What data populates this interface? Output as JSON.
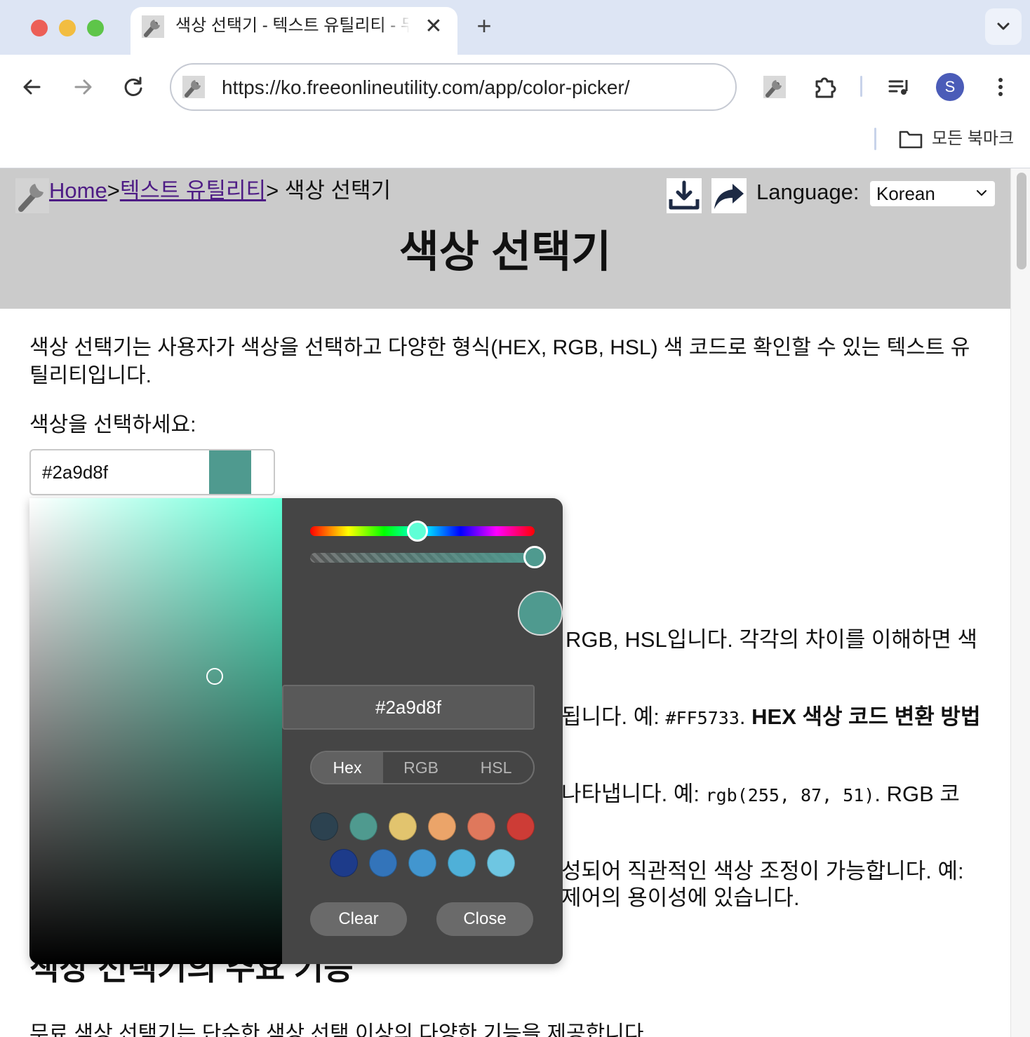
{
  "browser": {
    "tab_title": "색상 선택기 - 텍스트 유틸리티 - 무",
    "tab_close": "✕",
    "new_tab": "+",
    "url": "https://ko.freeonlineutility.com/app/color-picker/",
    "profile_initial": "S",
    "bookmarks_label": "모든 북마크"
  },
  "header": {
    "breadcrumb": {
      "home": "Home",
      "sep1": ">",
      "category": "텍스트 유틸리티",
      "sep2": ">",
      "current": " 색상 선택기"
    },
    "language_label": "Language:",
    "language_value": "Korean",
    "title": "색상 선택기"
  },
  "content": {
    "intro": "색상 선택기는 사용자가 색상을 선택하고 다양한 형식(HEX, RGB, HSL) 색 코드로 확인할 수 있는 텍스트 유틸리티입니다.",
    "pick_label": "색상을 선택하세요:",
    "input_value": "#2a9d8f",
    "line1": "RGB, HSL입니다. 각각의 차이를 이해하면 색",
    "line2_a": "됩니다. 예: ",
    "line2_code": "#FF5733",
    "line2_b": ". ",
    "line2_bold": "HEX 색상 코드 변환 방법",
    "line3_a": "나타냅니다. 예: ",
    "line3_code": "rgb(255, 87, 51)",
    "line3_b": ". RGB 코",
    "line4": "성되어 직관적인 색상 조정이 가능합니다. 예:",
    "line5": "제어의 용이성에 있습니다.",
    "section_title": "색상 선택기의 주요 기능",
    "section_body": "무료 색상 선택기는 단순한 색상 선택 이상의 다양한 기능을 제공합니다."
  },
  "picker": {
    "hex_value": "#2a9d8f",
    "formats": [
      "Hex",
      "RGB",
      "HSL"
    ],
    "active_format": "Hex",
    "clear_label": "Clear",
    "close_label": "Close",
    "selected_color": "#4f9a8f",
    "hue_color": "#5fffd6",
    "swatches_row1": [
      "#2c4250",
      "#4f9a8f",
      "#e2c46e",
      "#eba469",
      "#df785c",
      "#cd3c36"
    ],
    "swatches_row2": [
      "#1d3b8a",
      "#3374ba",
      "#4296cf",
      "#4fb0d8",
      "#6ec6e2"
    ]
  }
}
